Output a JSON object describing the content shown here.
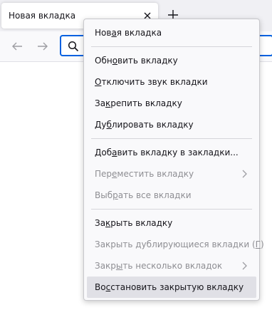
{
  "tab": {
    "title": "Новая вкладка"
  },
  "icons": {
    "close": "close-icon",
    "new_tab": "plus-icon",
    "back": "arrow-left-icon",
    "forward": "arrow-right-icon",
    "search": "search-icon",
    "submenu": "chevron-right-icon"
  },
  "colors": {
    "accent": "#0061e0",
    "menu_bg": "#f9f9fb",
    "hover_bg": "#e0e0e6",
    "disabled_text": "#8e8e93"
  },
  "menu": {
    "items": [
      {
        "pre": "Нов",
        "key": "а",
        "post": "я вкладка"
      },
      {
        "pre": "Обн",
        "key": "о",
        "post": "вить вкладку"
      },
      {
        "pre": "",
        "key": "О",
        "post": "тключить звук вкладки"
      },
      {
        "pre": "За",
        "key": "к",
        "post": "репить вкладку"
      },
      {
        "pre": "Ду",
        "key": "б",
        "post": "лировать вкладку"
      },
      {
        "pre": "Доб",
        "key": "а",
        "post": "вить вкладку в закладки..."
      },
      {
        "pre": "Пер",
        "key": "е",
        "post": "местить вкладку"
      },
      {
        "pre": "Выб",
        "key": "р",
        "post": "ать все вкладки"
      },
      {
        "pre": "За",
        "key": "к",
        "post": "рыть вкладку"
      },
      {
        "pre": "Закрыть дублирующиеся вкладки (",
        "key": "Г",
        "post": ")"
      },
      {
        "pre": "Закр",
        "key": "ы",
        "post": "ть несколько вкладок"
      },
      {
        "pre": "Во",
        "key": "с",
        "post": "становить закрытую вкладку"
      }
    ]
  }
}
